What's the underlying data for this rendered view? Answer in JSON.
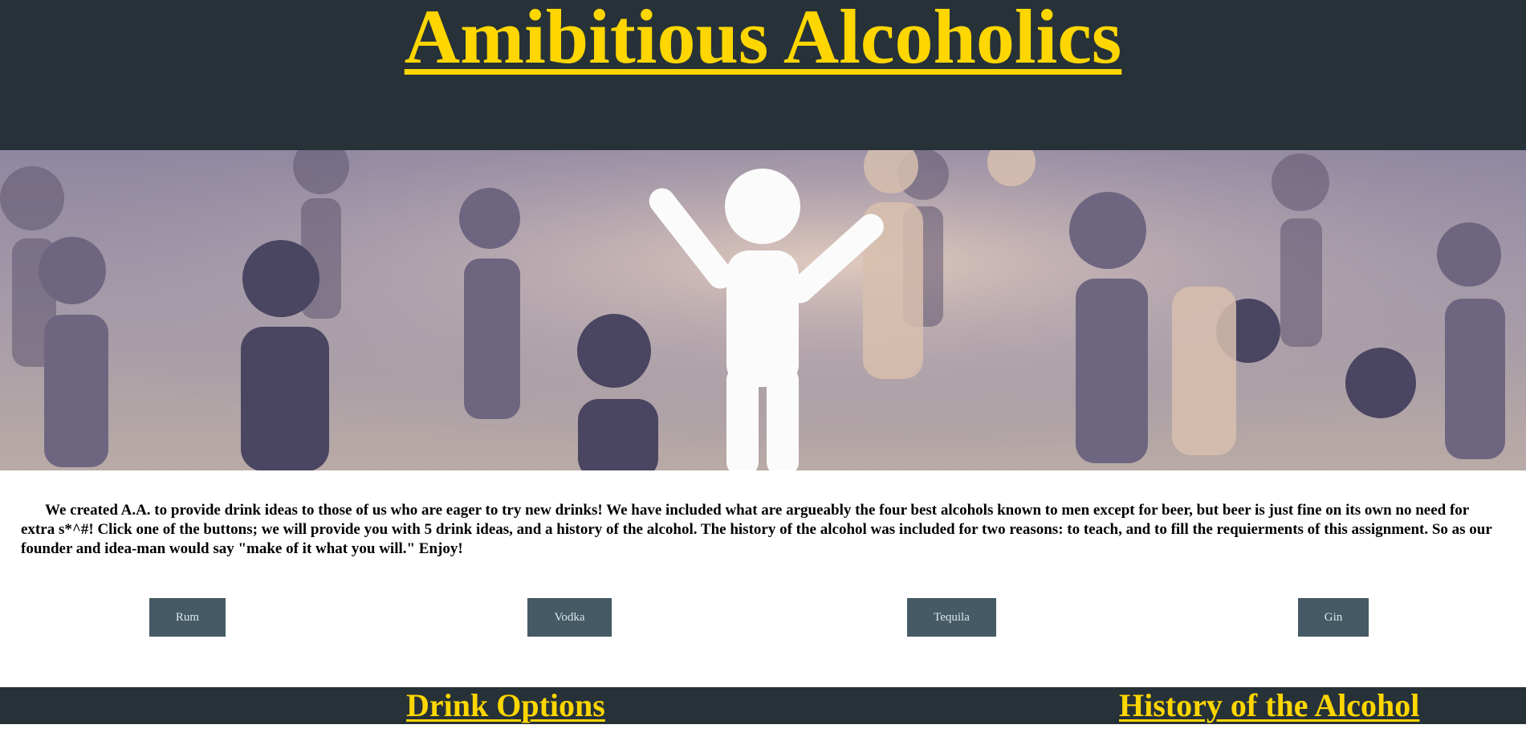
{
  "header": {
    "title": "Amibitious Alcoholics",
    "background_color": "#263238",
    "title_color": "#ffd600"
  },
  "hero": {
    "image_semantic": "crowd-of-figures-banner"
  },
  "intro": {
    "text": "We created A.A. to provide drink ideas to those of us who are eager to try new drinks! We have included what are argueably the four best alcohols known to men except for beer, but beer is just fine on its own no need for extra s*^#! Click one of the buttons; we will provide you with 5 drink ideas, and a history of the alcohol. The history of the alcohol was included for two reasons: to teach, and to fill the requierments of this assignment. So as our founder and idea-man would say \"make of it what you will.\" Enjoy!"
  },
  "buttons": {
    "rum": "Rum",
    "vodka": "Vodka",
    "tequila": "Tequila",
    "gin": "Gin",
    "color": "#455a64"
  },
  "footer": {
    "drink_options": "Drink Options",
    "history": "History of the Alcohol",
    "background_color": "#263238"
  }
}
